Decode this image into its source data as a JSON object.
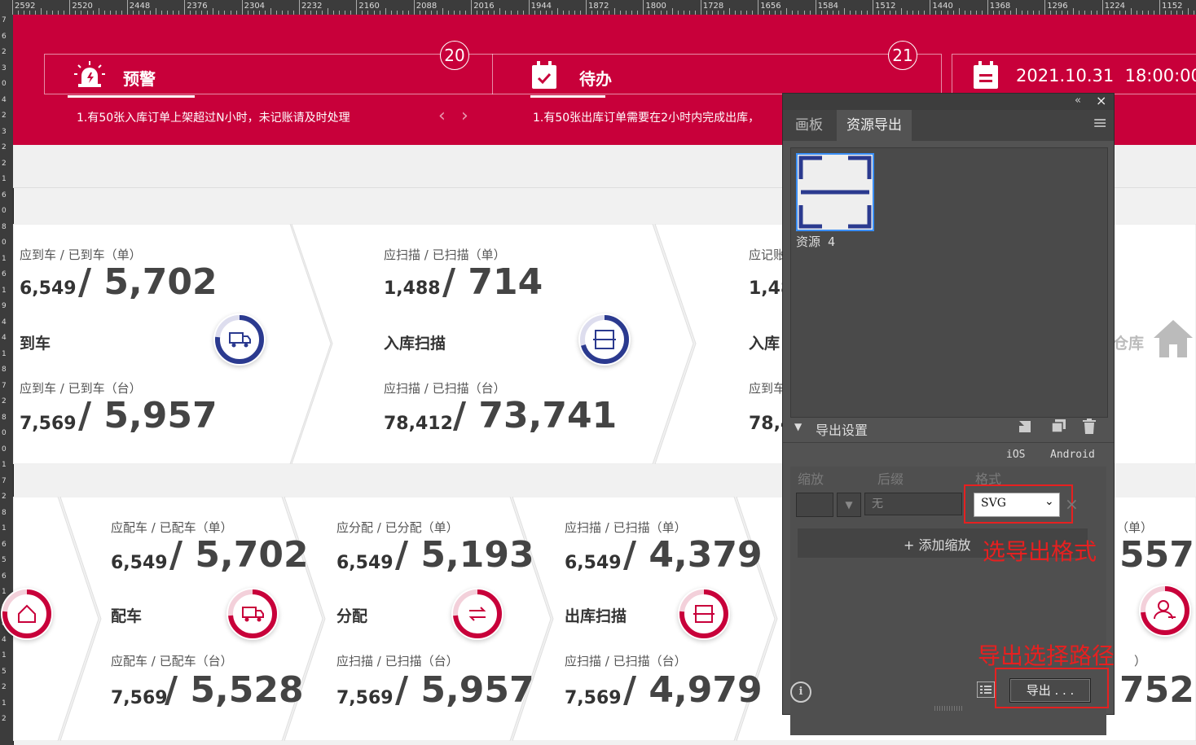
{
  "ruler": {
    "top_labels": [
      "2592",
      "2520",
      "2448",
      "2376",
      "2304",
      "2232",
      "2160",
      "2088",
      "2016",
      "1944",
      "1872",
      "1800",
      "1728",
      "1656",
      "1584",
      "1512",
      "1440",
      "1368",
      "1296",
      "1224",
      "1152"
    ],
    "left_labels": [
      "7",
      "6",
      "2",
      "3",
      "0",
      "4",
      "2",
      "3",
      "2",
      "2",
      "1",
      "6",
      "0",
      "8",
      "0",
      "1",
      "6",
      "1",
      "9",
      "4",
      "4",
      "1",
      "8",
      "7",
      "2",
      "8",
      "0",
      "0",
      "1",
      "7",
      "2",
      "8",
      "1",
      "6",
      "5",
      "6",
      "1",
      "7",
      "8",
      "4",
      "1",
      "5",
      "2",
      "1",
      "2"
    ]
  },
  "header": {
    "tab1": {
      "label": "预警",
      "badge": "20",
      "notice": "1.有50张入库订单上架超过N小时，未记账请及时处理"
    },
    "tab2": {
      "label": "待办",
      "badge": "21",
      "notice": "1.有50张出库订单需要在2小时内完成出库，"
    },
    "datetime": "2021.10.31  18:00:00",
    "prev": "‹",
    "next": "›"
  },
  "row1": [
    {
      "lbl1": "应到车 / 已到车（单）",
      "a1": "6,549",
      "b1": "/ 5,702",
      "name": "到车",
      "lbl2": "应到车 / 已到车（台）",
      "a2": "7,569",
      "b2": "/ 5,957",
      "icon": "truck-icon"
    },
    {
      "lbl1": "应扫描 / 已扫描（单）",
      "a1": "1,488",
      "b1": "/ 714",
      "name": "入库扫描",
      "lbl2": "应扫描 / 已扫描（台）",
      "a2": "78,412",
      "b2": "/ 73,741",
      "icon": "scan-icon"
    },
    {
      "lbl1": "应记账",
      "a1": "1,48",
      "name": "入库",
      "lbl2": "应到车",
      "a2": "78,4"
    }
  ],
  "row1_partial_right": {
    "name": "仓库",
    "icon": "home-icon"
  },
  "row2": [
    {
      "lbl1": "应配车 / 已配车（单）",
      "a1": "6,549",
      "b1": "/ 5,702",
      "name": "配车",
      "lbl2": "应配车 / 已配车（台）",
      "a2": "7,569",
      "b2": "/ 5,528",
      "icon": "truck-icon"
    },
    {
      "lbl1": "应分配 / 已分配（单）",
      "a1": "6,549",
      "b1": "/ 5,193",
      "name": "分配",
      "lbl2": "应扫描 / 已扫描（台）",
      "a2": "7,569",
      "b2": "/ 5,957",
      "icon": "transfer-icon"
    },
    {
      "lbl1": "应扫描 / 已扫描（单）",
      "a1": "6,549",
      "b1": "/ 4,379",
      "name": "出库扫描",
      "lbl2": "应扫描 / 已扫描（台）",
      "a2": "7,569",
      "b2": "/ 4,979",
      "icon": "scan-icon"
    }
  ],
  "row2_partial_right": {
    "lbl1": "（单）",
    "b1": "557",
    "lbl2": "）",
    "b2": "752",
    "icon": "user-icon"
  },
  "panel": {
    "collapse": "«",
    "close": "×",
    "tab_artboard": "画板",
    "tab_export": "资源导出",
    "menu": "≡",
    "asset_name": "资源 4",
    "export_settings": "导出设置",
    "ios": "iOS",
    "android": "Android",
    "col_scale": "缩放",
    "col_suffix": "后缀",
    "col_format": "格式",
    "suffix_placeholder": "无",
    "format_value": "SVG",
    "remove": "×",
    "add_scale": "+ 添加缩放",
    "export_button": "导出 . . .",
    "info": "i"
  },
  "annotations": {
    "format": "选导出格式",
    "path": "导出选择路径"
  },
  "colors": {
    "brand_red": "#c8003a",
    "navy": "#2b3a8f",
    "annotation": "#e62020"
  }
}
